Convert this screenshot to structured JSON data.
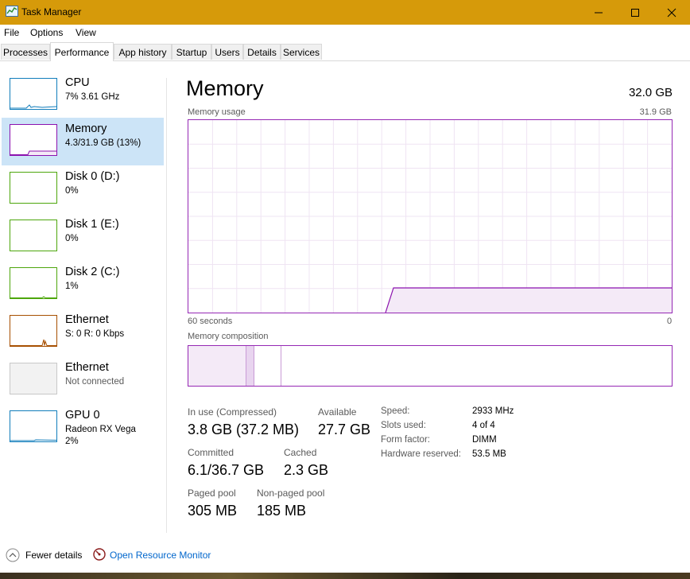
{
  "window": {
    "title": "Task Manager"
  },
  "menu": [
    "File",
    "Options",
    "View"
  ],
  "tabs": [
    "Processes",
    "Performance",
    "App history",
    "Startup",
    "Users",
    "Details",
    "Services"
  ],
  "sidebar": {
    "items": [
      {
        "name": "CPU",
        "sub": "7%  3.61 GHz",
        "sub2": "",
        "color": "#117dbb"
      },
      {
        "name": "Memory",
        "sub": "4.3/31.9 GB (13%)",
        "sub2": "",
        "color": "#8b12ae",
        "selected": true
      },
      {
        "name": "Disk 0 (D:)",
        "sub": "0%",
        "sub2": "",
        "color": "#4da60c"
      },
      {
        "name": "Disk 1 (E:)",
        "sub": "0%",
        "sub2": "",
        "color": "#4da60c"
      },
      {
        "name": "Disk 2 (C:)",
        "sub": "1%",
        "sub2": "",
        "color": "#4da60c"
      },
      {
        "name": "Ethernet",
        "sub": "S: 0  R: 0 Kbps",
        "sub2": "",
        "color": "#a74f01"
      },
      {
        "name": "Ethernet",
        "sub": "Not connected",
        "sub2": "",
        "color": "#c8c8c8"
      },
      {
        "name": "GPU 0",
        "sub": "Radeon RX Vega",
        "sub2": "2%",
        "color": "#117dbb"
      }
    ]
  },
  "main": {
    "title": "Memory",
    "total": "32.0 GB",
    "usage_label": "Memory usage",
    "usage_max": "31.9 GB",
    "time_left": "60 seconds",
    "time_right": "0",
    "composition_label": "Memory composition",
    "stats": {
      "in_use_label": "In use (Compressed)",
      "in_use_value": "3.8 GB (37.2 MB)",
      "available_label": "Available",
      "available_value": "27.7 GB",
      "committed_label": "Committed",
      "committed_value": "6.1/36.7 GB",
      "cached_label": "Cached",
      "cached_value": "2.3 GB",
      "paged_label": "Paged pool",
      "paged_value": "305 MB",
      "nonpaged_label": "Non-paged pool",
      "nonpaged_value": "185 MB"
    },
    "details": [
      {
        "label": "Speed:",
        "value": "2933 MHz"
      },
      {
        "label": "Slots used:",
        "value": "4 of 4"
      },
      {
        "label": "Form factor:",
        "value": "DIMM"
      },
      {
        "label": "Hardware reserved:",
        "value": "53.5 MB"
      }
    ]
  },
  "footer": {
    "fewer_details": "Fewer details",
    "open_monitor": "Open Resource Monitor"
  },
  "colors": {
    "titlebar": "#d69a0a",
    "memory": "#8b12ae",
    "link": "#0066cc",
    "selected": "#cce4f7"
  }
}
